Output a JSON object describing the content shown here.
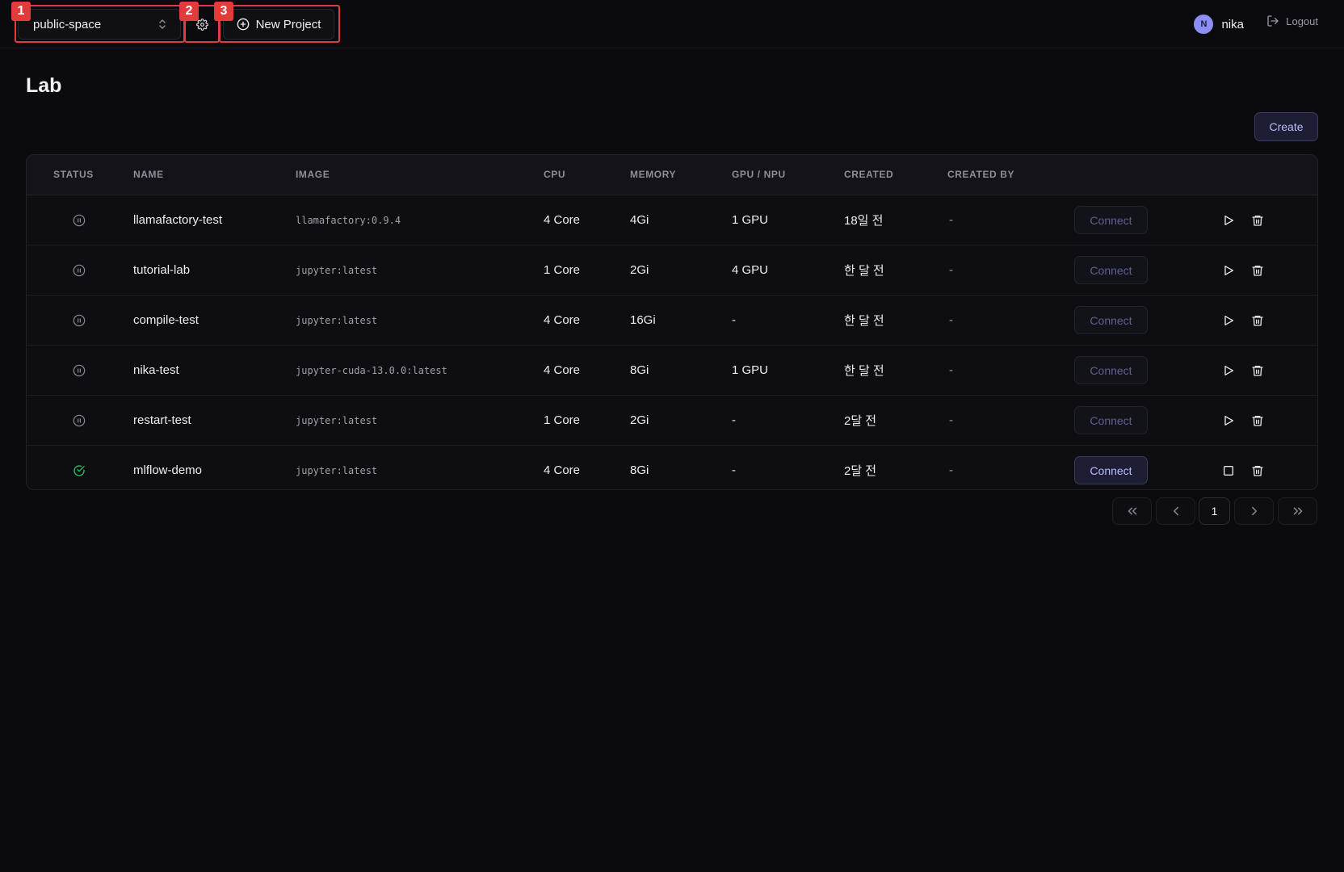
{
  "topbar": {
    "workspace": "public-space",
    "new_project_label": "New Project",
    "user": {
      "initial": "N",
      "name": "nika"
    },
    "logout_label": "Logout",
    "marks": [
      "1",
      "2",
      "3"
    ]
  },
  "page": {
    "title": "Lab",
    "create_label": "Create"
  },
  "table": {
    "headers": [
      "STATUS",
      "NAME",
      "IMAGE",
      "CPU",
      "MEMORY",
      "GPU / NPU",
      "CREATED",
      "CREATED BY"
    ],
    "rows": [
      {
        "status": "paused",
        "name": "llamafactory-test",
        "image": "llamafactory:0.9.4",
        "cpu": "4 Core",
        "memory": "4Gi",
        "gpu": "1 GPU",
        "created": "18일 전",
        "created_by": "-",
        "connect": "Connect",
        "action": "play"
      },
      {
        "status": "paused",
        "name": "tutorial-lab",
        "image": "jupyter:latest",
        "cpu": "1 Core",
        "memory": "2Gi",
        "gpu": "4 GPU",
        "created": "한 달 전",
        "created_by": "-",
        "connect": "Connect",
        "action": "play"
      },
      {
        "status": "paused",
        "name": "compile-test",
        "image": "jupyter:latest",
        "cpu": "4 Core",
        "memory": "16Gi",
        "gpu": "-",
        "created": "한 달 전",
        "created_by": "-",
        "connect": "Connect",
        "action": "play"
      },
      {
        "status": "paused",
        "name": "nika-test",
        "image": "jupyter-cuda-13.0.0:latest",
        "cpu": "4 Core",
        "memory": "8Gi",
        "gpu": "1 GPU",
        "created": "한 달 전",
        "created_by": "-",
        "connect": "Connect",
        "action": "play"
      },
      {
        "status": "paused",
        "name": "restart-test",
        "image": "jupyter:latest",
        "cpu": "1 Core",
        "memory": "2Gi",
        "gpu": "-",
        "created": "2달 전",
        "created_by": "-",
        "connect": "Connect",
        "action": "play"
      },
      {
        "status": "running",
        "name": "mlflow-demo",
        "image": "jupyter:latest",
        "cpu": "4 Core",
        "memory": "8Gi",
        "gpu": "-",
        "created": "2달 전",
        "created_by": "-",
        "connect": "Connect",
        "action": "stop"
      }
    ]
  },
  "pagination": {
    "current_page": "1"
  },
  "colors": {
    "background": "#0b0b0f",
    "accent": "#b9bcff",
    "running": "#22c55e",
    "marker": "#e23b3b"
  }
}
